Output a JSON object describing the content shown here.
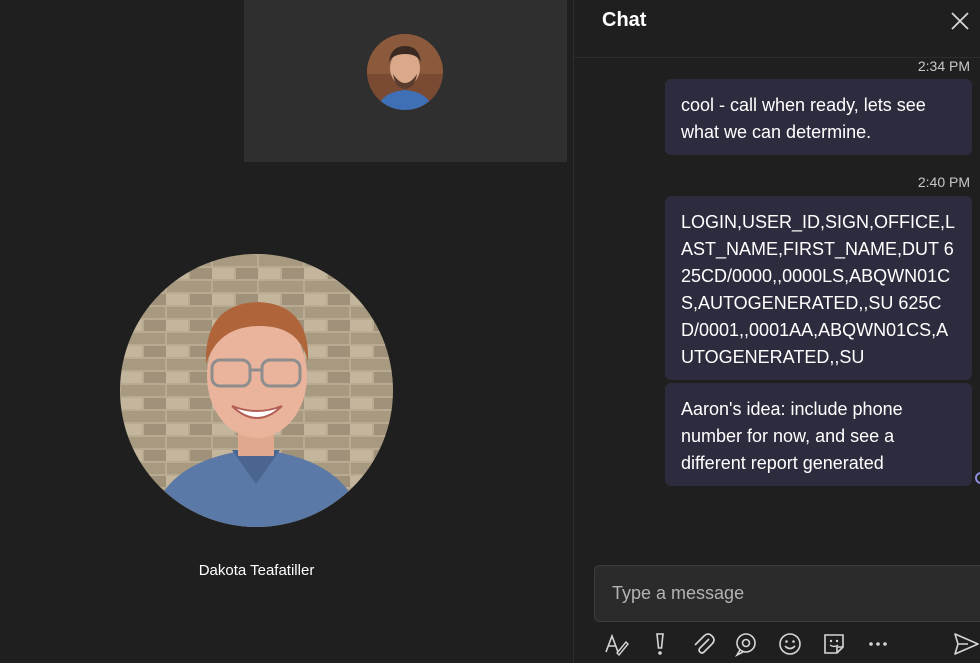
{
  "stage": {
    "participant_name": "Dakota Teafatiller"
  },
  "chat": {
    "title": "Chat",
    "messages": [
      {
        "time": "2:34 PM",
        "text": "cool - call when ready, lets see what we can determine."
      },
      {
        "time": "2:40 PM",
        "text": "LOGIN,USER_ID,SIGN,OFFICE,LAST_NAME,FIRST_NAME,DUT 625CD/0000,,0000LS,ABQWN01CS,AUTOGENERATED,,SU 625CD/0001,,0001AA,ABQWN01CS,AUTOGENERATED,,SU"
      },
      {
        "time": "",
        "text": "Aaron's idea: include phone number for now, and see a different report generated"
      }
    ],
    "composer_placeholder": "Type a message"
  },
  "colors": {
    "background": "#1f1f1f",
    "bubble": "#2d2c3e",
    "accent": "#8b8cdb"
  },
  "icons": [
    "close-icon",
    "format-icon",
    "important-icon",
    "attach-icon",
    "loop-icon",
    "emoji-icon",
    "sticker-icon",
    "more-icon",
    "send-icon"
  ]
}
